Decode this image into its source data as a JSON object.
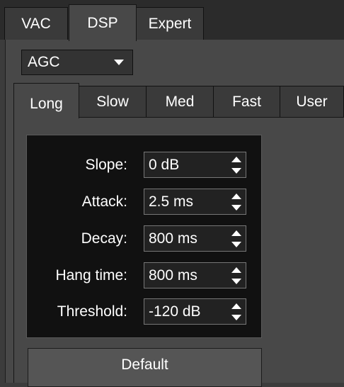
{
  "top_tabs": [
    {
      "label": "VAC"
    },
    {
      "label": "DSP",
      "active": true
    },
    {
      "label": "Expert"
    }
  ],
  "mode_select": {
    "value": "AGC"
  },
  "agc_tabs": [
    {
      "label": "Long",
      "active": true
    },
    {
      "label": "Slow"
    },
    {
      "label": "Med"
    },
    {
      "label": "Fast"
    },
    {
      "label": "User"
    }
  ],
  "params": [
    {
      "label": "Slope:",
      "value": "0 dB"
    },
    {
      "label": "Attack:",
      "value": "2.5 ms"
    },
    {
      "label": "Decay:",
      "value": "800 ms"
    },
    {
      "label": "Hang time:",
      "value": "800 ms"
    },
    {
      "label": "Threshold:",
      "value": "-120 dB"
    }
  ],
  "default_button": {
    "label": "Default"
  }
}
